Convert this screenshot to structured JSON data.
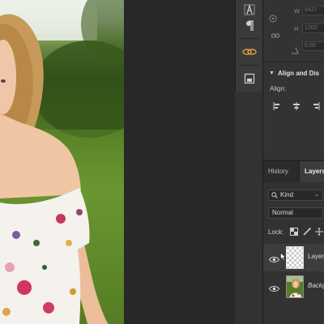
{
  "canvas": {
    "photo_subject": "woman in floral off-shoulder top"
  },
  "properties": {
    "w_label": "W",
    "h_label": "H",
    "x_value": "9427",
    "y_value": "1200",
    "angle_value": "0.00",
    "align_section_title": "Align and Dis",
    "align_label": "Align:"
  },
  "layers_panel": {
    "tabs": [
      "History",
      "Layers"
    ],
    "filter_kind": "Kind",
    "blend_mode": "Normal",
    "lock_label": "Lock:",
    "layers": [
      {
        "name": "Layer",
        "selected": true
      },
      {
        "name": "Backgr",
        "italic": true,
        "selected": false
      }
    ]
  },
  "colors": {
    "panel_bg": "#333333",
    "work_area": "#282828",
    "selected_row": "#3d3d3d",
    "accent_link": "#d7a23a"
  },
  "icons": [
    "type-icon",
    "paragraph-icon",
    "brush-link-icon",
    "frame-icon",
    "search-icon",
    "eye-icon",
    "link-icon"
  ]
}
